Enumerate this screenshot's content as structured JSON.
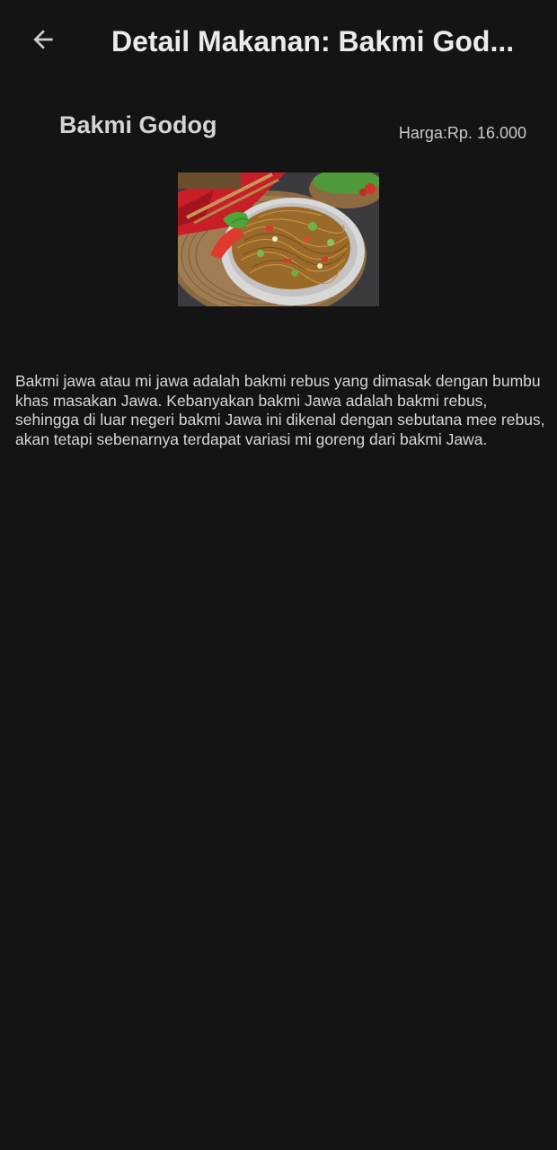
{
  "app_bar": {
    "back_icon": "arrow-left-icon",
    "title": "Detail Makanan: Bakmi God..."
  },
  "food": {
    "name": "Bakmi Godog",
    "price_label": "Harga:",
    "price_value": "Rp. 16.000",
    "image": "noodle-dish-photo",
    "description": "Bakmi jawa atau mi jawa adalah bakmi rebus yang dimasak dengan bumbu khas masakan Jawa. Kebanyakan bakmi Jawa adalah bakmi rebus, sehingga di luar negeri bakmi Jawa ini dikenal dengan sebutana mee rebus, akan tetapi sebenarnya terdapat variasi mi goreng dari bakmi Jawa."
  },
  "colors": {
    "background": "#141414",
    "title_text": "#ebebeb",
    "body_text": "#d6d6d6"
  }
}
